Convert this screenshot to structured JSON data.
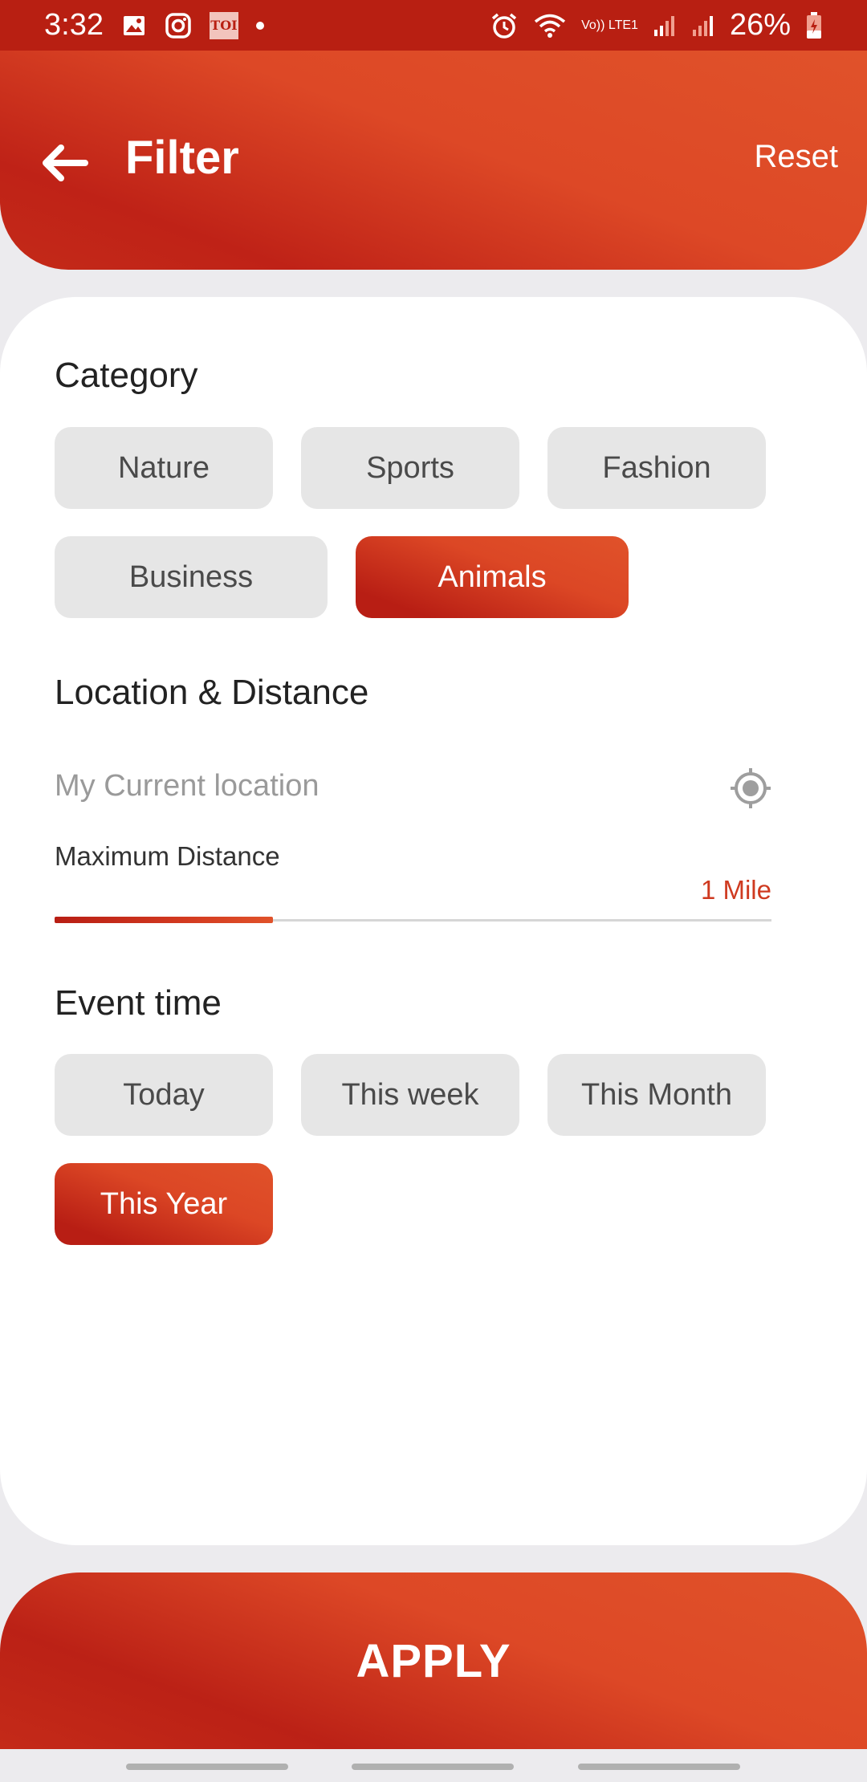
{
  "status_bar": {
    "time": "3:32",
    "toi_label": "TOI",
    "network_label": "Vo)) LTE1",
    "battery": "26%"
  },
  "header": {
    "title": "Filter",
    "reset_label": "Reset"
  },
  "category": {
    "title": "Category",
    "chips": [
      {
        "label": "Nature",
        "selected": false
      },
      {
        "label": "Sports",
        "selected": false
      },
      {
        "label": "Fashion",
        "selected": false
      },
      {
        "label": "Business",
        "selected": false
      },
      {
        "label": "Animals",
        "selected": true
      }
    ]
  },
  "location": {
    "title": "Location & Distance",
    "placeholder": "My Current location",
    "distance_label": "Maximum Distance",
    "distance_value": "1 Mile",
    "slider_fraction": 0.305
  },
  "event_time": {
    "title": "Event time",
    "chips": [
      {
        "label": "Today",
        "selected": false
      },
      {
        "label": "This week",
        "selected": false
      },
      {
        "label": "This Month",
        "selected": false
      },
      {
        "label": "This Year",
        "selected": true
      }
    ]
  },
  "apply_label": "APPLY",
  "colors": {
    "accent": "#dd4826",
    "accent_dark": "#b81f12",
    "chip_bg": "#e6e6e6",
    "background": "#ecebee"
  },
  "icons": [
    "image-icon",
    "instagram-icon",
    "toi-icon",
    "alarm-icon",
    "wifi-icon",
    "signal-icon",
    "battery-icon",
    "back-arrow-icon",
    "locate-icon"
  ]
}
